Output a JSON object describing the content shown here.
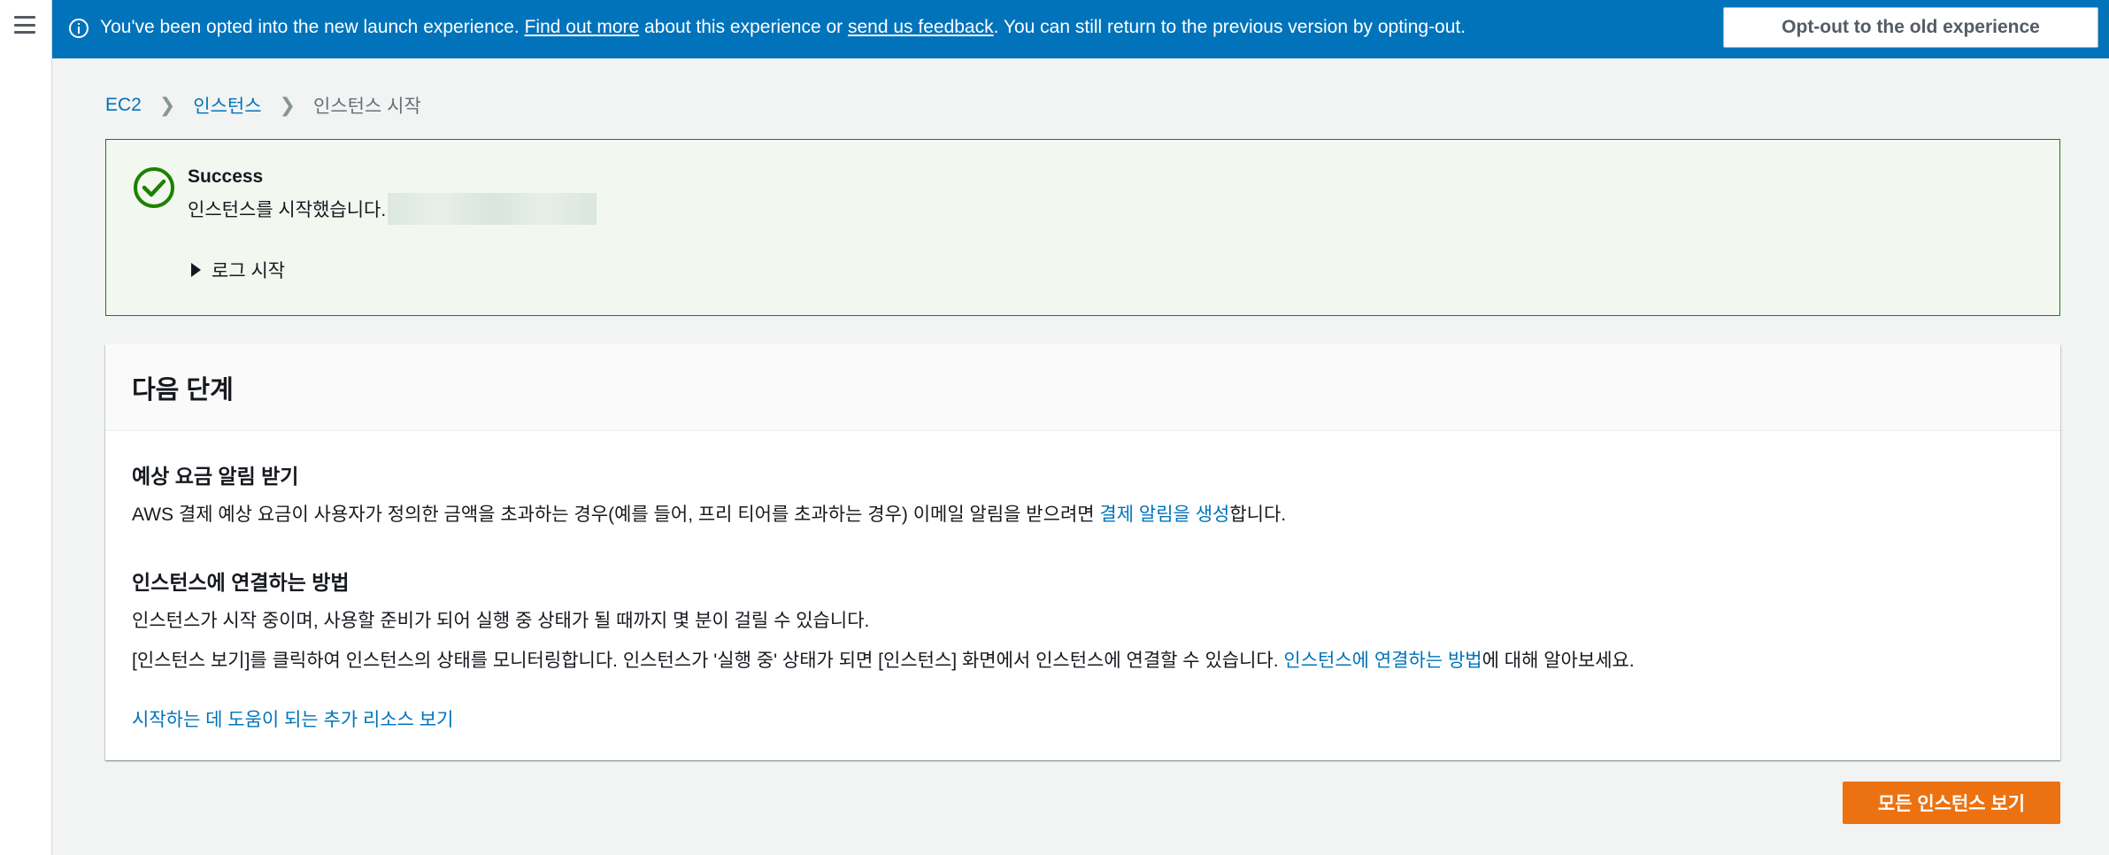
{
  "nav": {
    "menu_icon": "hamburger-icon"
  },
  "flashbar": {
    "icon": "info-icon",
    "text_before": "You've been opted into the new launch experience. ",
    "link_find_out": "Find out more",
    "text_middle": " about this experience or ",
    "link_feedback": "send us feedback",
    "text_after": ". You can still return to the previous version by opting-out.",
    "optout_label": "Opt-out to the old experience",
    "close_icon": "close-icon",
    "bg_color": "#0073bb"
  },
  "breadcrumb": {
    "items": [
      "EC2",
      "인스턴스"
    ],
    "current": "인스턴스 시작"
  },
  "success": {
    "icon": "check-circle-icon",
    "title": "Success",
    "message": "인스턴스를 시작했습니다.",
    "log_toggle": "로그 시작",
    "color": "#1d8102"
  },
  "next_steps": {
    "title": "다음 단계",
    "billing": {
      "heading": "예상 요금 알림 받기",
      "text": "AWS 결제 예상 요금이 사용자가 정의한 금액을 초과하는 경우(예를 들어, 프리 티어를 초과하는 경우) 이메일 알림을 받으려면 ",
      "link": "결제 알림을 생성",
      "suffix": "합니다."
    },
    "connect": {
      "heading": "인스턴스에 연결하는 방법",
      "line1": "인스턴스가 시작 중이며, 사용할 준비가 되어 실행 중 상태가 될 때까지 몇 분이 걸릴 수 있습니다.",
      "line2": "[인스턴스 보기]를 클릭하여 인스턴스의 상태를 모니터링합니다. 인스턴스가 '실행 중' 상태가 되면 [인스턴스] 화면에서 인스턴스에 연결할 수 있습니다. ",
      "link": "인스턴스에 연결하는 방법",
      "suffix": "에 대해 알아보세요."
    },
    "more_link": "시작하는 데 도움이 되는 추가 리소스 보기"
  },
  "actions": {
    "view_all_label": "모든 인스턴스 보기",
    "primary_color": "#ec7211"
  }
}
